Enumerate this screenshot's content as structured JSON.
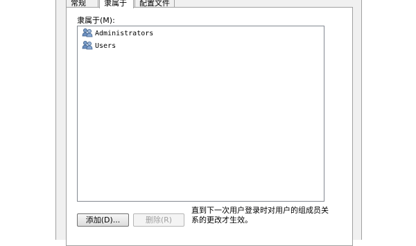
{
  "tabs": [
    {
      "label": "常规"
    },
    {
      "label": "隶属于"
    },
    {
      "label": "配置文件"
    }
  ],
  "member_of": {
    "label": "隶属于(M):",
    "items": [
      {
        "name": "Administrators",
        "icon": "user-group-icon"
      },
      {
        "name": "Users",
        "icon": "user-group-icon"
      }
    ]
  },
  "buttons": {
    "add_label": "添加(D)...",
    "remove_label": "删除(R)"
  },
  "hint": "直到下一次用户登录时对用户的组成员关系的更改才生效。",
  "colors": {
    "dialog_bg": "#f0f0f0",
    "panel_bg": "#ffffff",
    "border": "#a0a0a0",
    "disabled_text": "#a0a0a0"
  }
}
